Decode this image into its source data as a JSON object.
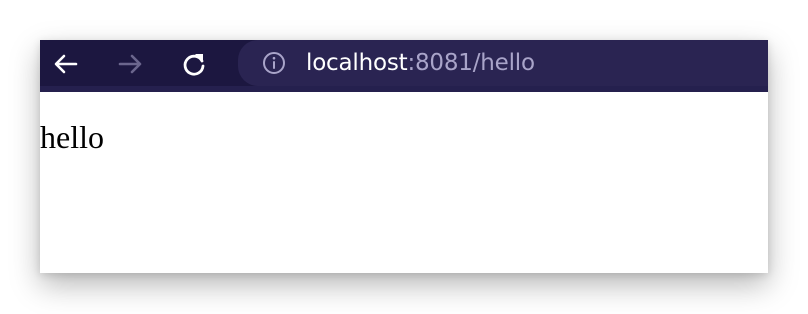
{
  "browser": {
    "url_host": "localhost",
    "url_rest": ":8081/hello",
    "back_icon": "arrow-left-icon",
    "forward_icon": "arrow-right-icon",
    "reload_icon": "reload-icon",
    "site_info_icon": "info-icon",
    "colors": {
      "toolbar_bg": "#1c1740",
      "urlbar_bg": "#2a2452",
      "url_host": "#ffffff",
      "url_rest": "#a9a4c9",
      "icon_active": "#ffffff",
      "icon_disabled": "#6b668d"
    }
  },
  "page": {
    "body_text": "hello"
  }
}
